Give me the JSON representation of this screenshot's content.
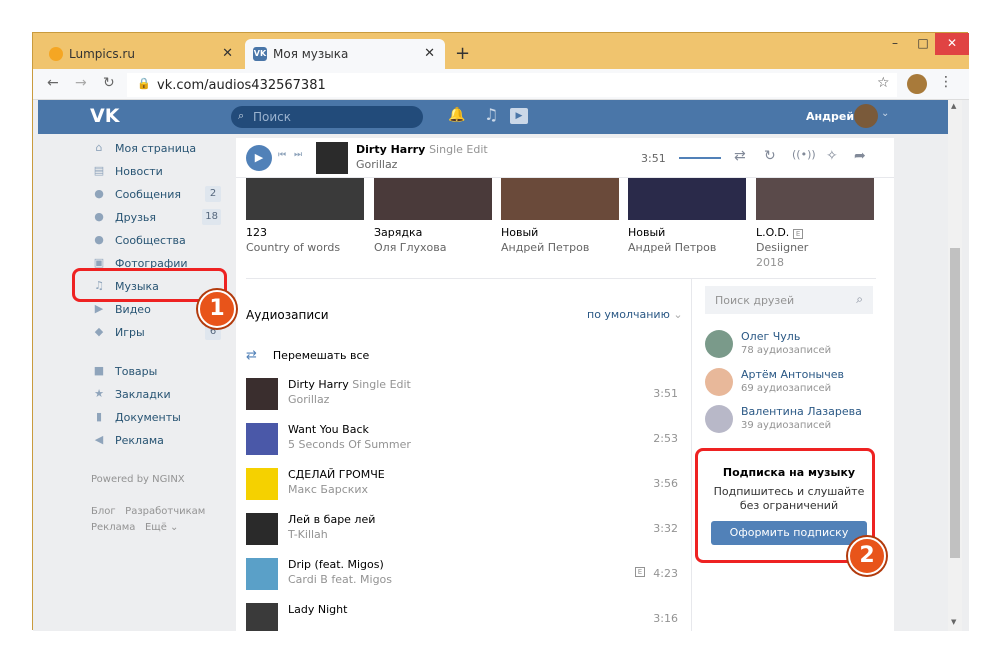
{
  "browser": {
    "tabs": [
      {
        "title": "Lumpics.ru"
      },
      {
        "title": "Моя музыка",
        "favicon_text": "VK"
      }
    ],
    "new_tab": "+",
    "url": "vk.com/audios432567381",
    "window_controls": {
      "minimize": "–",
      "maximize": "□",
      "close": "✕"
    }
  },
  "header": {
    "logo": "VK",
    "search_placeholder": "Поиск",
    "user_name": "Андрей"
  },
  "sidebar": {
    "items": [
      {
        "label": "Моя страница",
        "icon": "home-icon"
      },
      {
        "label": "Новости",
        "icon": "news-icon"
      },
      {
        "label": "Сообщения",
        "icon": "messages-icon",
        "count": "2"
      },
      {
        "label": "Друзья",
        "icon": "friends-icon",
        "count": "18"
      },
      {
        "label": "Сообщества",
        "icon": "communities-icon"
      },
      {
        "label": "Фотографии",
        "icon": "photos-icon"
      },
      {
        "label": "Музыка",
        "icon": "music-icon"
      },
      {
        "label": "Видео",
        "icon": "video-icon"
      },
      {
        "label": "Игры",
        "icon": "games-icon",
        "count": "6"
      },
      {
        "label": "Товары",
        "icon": "goods-icon"
      },
      {
        "label": "Закладки",
        "icon": "bookmarks-icon"
      },
      {
        "label": "Документы",
        "icon": "documents-icon"
      },
      {
        "label": "Реклама",
        "icon": "ads-icon"
      }
    ],
    "powered": "Powered by NGINX",
    "footer": {
      "blog": "Блог",
      "devs": "Разработчикам",
      "ads": "Реклама",
      "more": "Ещё"
    }
  },
  "player": {
    "title": "Dirty Harry",
    "subtitle": "Single Edit",
    "artist": "Gorillaz",
    "time": "3:51"
  },
  "albums": [
    {
      "title": "123",
      "artist": "Country of words",
      "year": ""
    },
    {
      "title": "Зарядка",
      "artist": "Оля Глухова",
      "year": ""
    },
    {
      "title": "Новый",
      "artist": "Андрей Петров",
      "year": ""
    },
    {
      "title": "Новый",
      "artist": "Андрей Петров",
      "year": ""
    },
    {
      "title": "L.O.D.",
      "artist": "Desiigner",
      "year": "2018",
      "explicit": "E"
    }
  ],
  "audio": {
    "title": "Аудиозаписи",
    "sort": "по умолчанию",
    "shuffle": "Перемешать все",
    "tracks": [
      {
        "title": "Dirty Harry",
        "subtitle": "Single Edit",
        "artist": "Gorillaz",
        "duration": "3:51",
        "explicit": ""
      },
      {
        "title": "Want You Back",
        "subtitle": "",
        "artist": "5 Seconds Of Summer",
        "duration": "2:53",
        "explicit": ""
      },
      {
        "title": "СДЕЛАЙ ГРОМЧЕ",
        "subtitle": "",
        "artist": "Макс Барских",
        "duration": "3:56",
        "explicit": ""
      },
      {
        "title": "Лей в баре лей",
        "subtitle": "",
        "artist": "T-Killah",
        "duration": "3:32",
        "explicit": ""
      },
      {
        "title": "Drip (feat. Migos)",
        "subtitle": "",
        "artist": "Cardi B feat. Migos",
        "duration": "4:23",
        "explicit": "E"
      },
      {
        "title": "Lady Night",
        "subtitle": "",
        "artist": "",
        "duration": "3:16",
        "explicit": ""
      }
    ]
  },
  "friends": {
    "search_placeholder": "Поиск друзей",
    "list": [
      {
        "name": "Олег Чуль",
        "count": "78 аудиозаписей"
      },
      {
        "name": "Артём Антонычев",
        "count": "69 аудиозаписей"
      },
      {
        "name": "Валентина Лазарева",
        "count": "39 аудиозаписей"
      }
    ]
  },
  "subscription": {
    "title": "Подписка на музыку",
    "text": "Подпишитесь и слушайте без ограничений",
    "button": "Оформить подписку"
  },
  "annotations": {
    "badge1": "1",
    "badge2": "2"
  },
  "colors": {
    "vk_blue": "#4a76a8",
    "highlight": "#ee2222",
    "badge": "#e8541a"
  }
}
